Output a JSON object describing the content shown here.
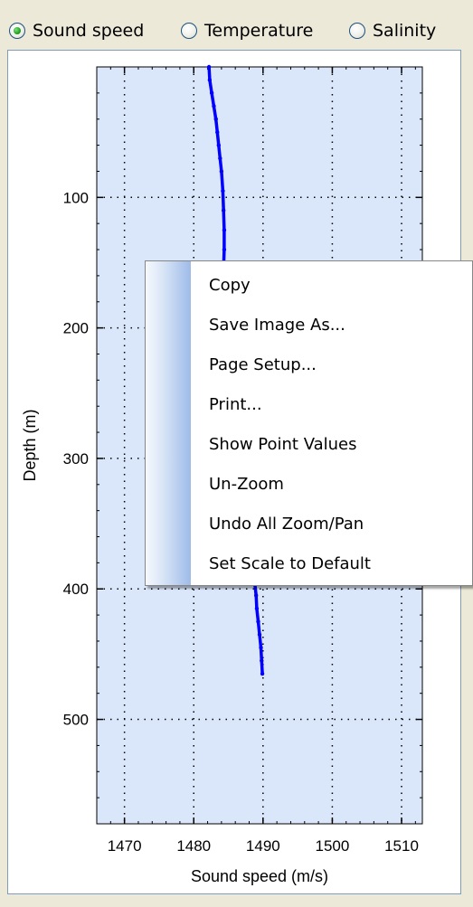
{
  "radio_group": {
    "options": [
      {
        "label": "Sound speed",
        "selected": true
      },
      {
        "label": "Temperature",
        "selected": false
      },
      {
        "label": "Salinity",
        "selected": false
      }
    ]
  },
  "chart_data": {
    "type": "line",
    "title": "",
    "xlabel": "Sound speed (m/s)",
    "ylabel": "Depth (m)",
    "xlim": [
      1466,
      1513
    ],
    "ylim": [
      0,
      580
    ],
    "y_inverted": true,
    "x_ticks": [
      1470,
      1480,
      1490,
      1500,
      1510
    ],
    "y_ticks": [
      100,
      200,
      300,
      400,
      500
    ],
    "grid": true,
    "plot_background": "#dae7fb",
    "series": [
      {
        "color": "#0000ff",
        "points": [
          [
            1482.2,
            0
          ],
          [
            1482.3,
            10
          ],
          [
            1482.6,
            20
          ],
          [
            1482.9,
            30
          ],
          [
            1483.2,
            40
          ],
          [
            1483.4,
            50
          ],
          [
            1483.6,
            60
          ],
          [
            1483.8,
            70
          ],
          [
            1484.0,
            80
          ],
          [
            1484.2,
            95
          ],
          [
            1484.3,
            110
          ],
          [
            1484.4,
            125
          ],
          [
            1484.4,
            140
          ],
          [
            1484.3,
            155
          ],
          [
            1484.1,
            170
          ],
          [
            1488.8,
            395
          ],
          [
            1489.0,
            405
          ],
          [
            1489.1,
            415
          ],
          [
            1489.3,
            425
          ],
          [
            1489.5,
            435
          ],
          [
            1489.7,
            445
          ],
          [
            1489.8,
            455
          ],
          [
            1489.9,
            465
          ]
        ]
      }
    ]
  },
  "context_menu": {
    "items": [
      {
        "label": "Copy"
      },
      {
        "label": "Save Image As..."
      },
      {
        "label": "Page Setup..."
      },
      {
        "label": "Print..."
      },
      {
        "label": "Show Point Values"
      },
      {
        "label": "Un-Zoom"
      },
      {
        "label": "Undo All Zoom/Pan"
      },
      {
        "label": "Set Scale to Default"
      }
    ]
  }
}
